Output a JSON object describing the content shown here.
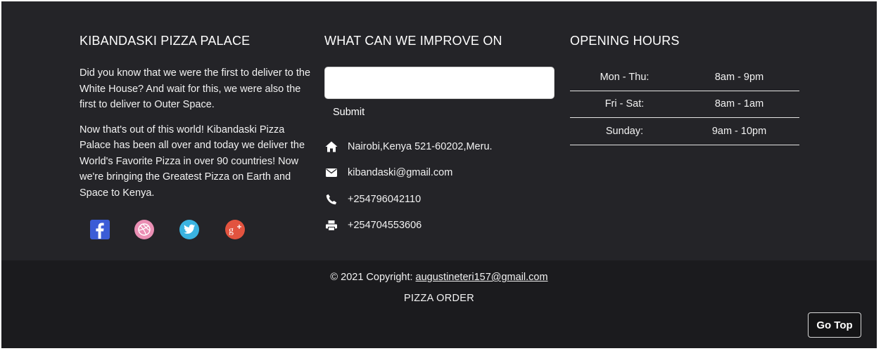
{
  "about": {
    "title": "KIBANDASKI PIZZA PALACE",
    "paragraph1": "Did you know that we were the first to deliver to the White House? And wait for this, we were also the first to deliver to Outer Space.",
    "paragraph2": "Now that's out of this world! Kibandaski Pizza Palace has been all over and today we deliver the World's Favorite Pizza in over 90 countries! Now we're bringing the Greatest Pizza on Earth and Space to Kenya.",
    "socials": [
      {
        "icon": "facebook-icon",
        "color": "#3b5cd6"
      },
      {
        "icon": "dribbble-icon",
        "color": "#ea8fb4"
      },
      {
        "icon": "twitter-icon",
        "color": "#3ab3e0"
      },
      {
        "icon": "google-plus-icon",
        "color": "#e2533f"
      }
    ]
  },
  "feedback": {
    "title": "WHAT CAN WE IMPROVE ON",
    "input_value": "",
    "submit_label": "Submit"
  },
  "contact": {
    "address": "Nairobi,Kenya 521-60202,Meru.",
    "email": "kibandaski@gmail.com",
    "phone": "+254796042110",
    "fax": "+254704553606",
    "icons": [
      "home-icon",
      "envelope-icon",
      "phone-icon",
      "printer-icon"
    ]
  },
  "hours": {
    "title": "OPENING HOURS",
    "rows": [
      {
        "day": "Mon - Thu:",
        "time": "8am - 9pm"
      },
      {
        "day": "Fri - Sat:",
        "time": "8am - 1am"
      },
      {
        "day": "Sunday:",
        "time": "9am - 10pm"
      }
    ]
  },
  "footer": {
    "copyright_prefix": "© 2021 Copyright: ",
    "copyright_email": "augustineteri157@gmail.com",
    "brand": "PIZZA ORDER",
    "go_top_label": "Go Top"
  },
  "colors": {
    "main_bg": "#242428",
    "bottom_bg": "#1b1b1e"
  }
}
